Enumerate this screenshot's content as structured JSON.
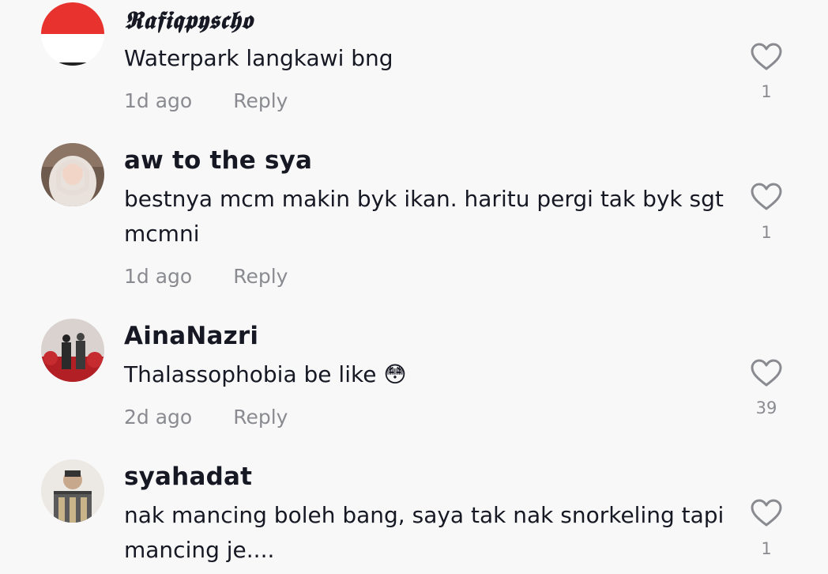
{
  "comments": [
    {
      "username": "𝕽𝖆𝖋𝖎𝖖𝖕𝖞𝖘𝖈𝖍𝖔",
      "text": "Waterpark langkawi bng",
      "time": "1d ago",
      "reply_label": "Reply",
      "likes": "1"
    },
    {
      "username": "aw to the sya",
      "text": "bestnya mcm makin byk ikan. haritu pergi tak byk sgt mcmni",
      "time": "1d ago",
      "reply_label": "Reply",
      "likes": "1"
    },
    {
      "username": "AinaNazri",
      "text": "Thalassophobia be like 😳",
      "time": "2d ago",
      "reply_label": "Reply",
      "likes": "39"
    },
    {
      "username": "syahadat",
      "text": "nak mancing boleh bang, saya tak nak snorkeling tapi mancing je....",
      "time": "",
      "reply_label": "",
      "likes": "1"
    }
  ],
  "icons": {
    "like": "heart-outline-icon"
  },
  "colors": {
    "background": "#f8f8f8",
    "text": "#161823",
    "secondary": "#8a8b91"
  }
}
